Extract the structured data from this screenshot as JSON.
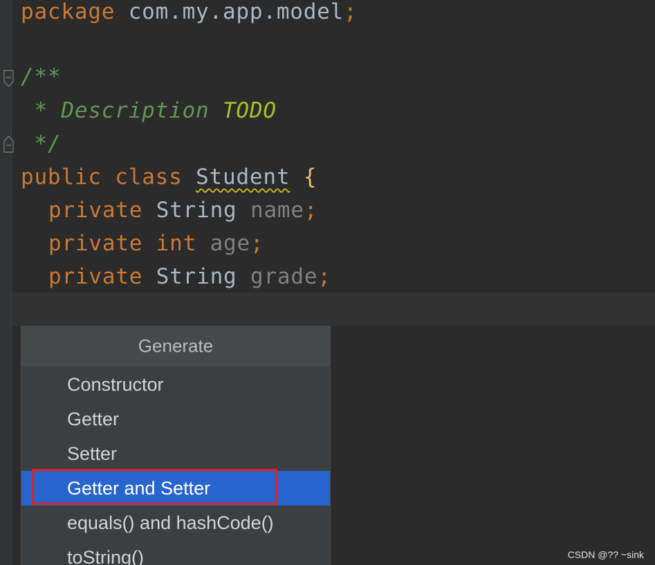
{
  "editor": {
    "package_line": {
      "keyword": "package",
      "name": " com.my.app.model",
      "semi": ";"
    },
    "doc_open": "/**",
    "doc_desc_prefix": " * Description ",
    "doc_todo": "TODO",
    "doc_close": " */",
    "class_line": {
      "public": "public",
      "class": "class",
      "name": "Student",
      "brace": "{"
    },
    "fields": [
      {
        "modifier": "private",
        "type": "String",
        "name": "name",
        "semi": ";"
      },
      {
        "modifier": "private",
        "type": "int",
        "name": "age",
        "semi": ";"
      },
      {
        "modifier": "private",
        "type": "String",
        "name": "grade",
        "semi": ";"
      }
    ]
  },
  "generate_popup": {
    "title": "Generate",
    "items": [
      {
        "label": "Constructor",
        "selected": false
      },
      {
        "label": "Getter",
        "selected": false
      },
      {
        "label": "Setter",
        "selected": false
      },
      {
        "label": "Getter and Setter",
        "selected": true
      },
      {
        "label": "equals() and hashCode()",
        "selected": false
      },
      {
        "label": "toString()",
        "selected": false
      }
    ]
  },
  "watermark": "CSDN @??  ~sink",
  "colors": {
    "editor_background": "#2b2b2b",
    "keyword": "#cc7832",
    "doc_comment": "#629755",
    "todo": "#a8c023",
    "selection": "#2764ce",
    "annotation_box": "#e62117"
  }
}
